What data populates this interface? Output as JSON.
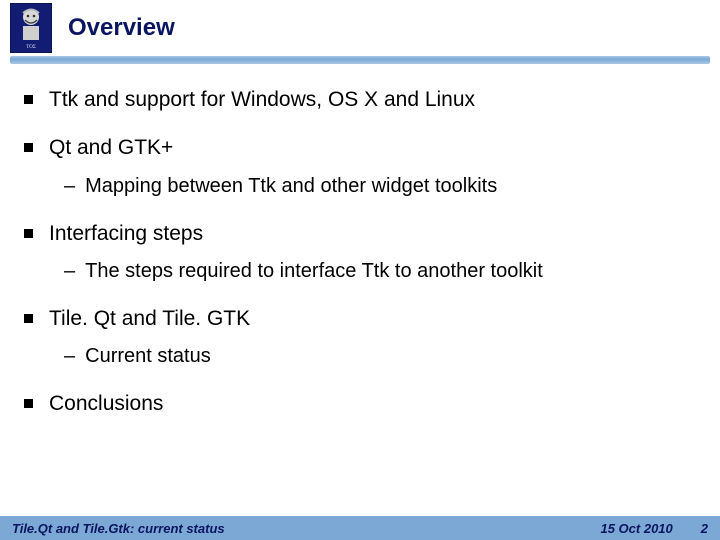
{
  "header": {
    "title": "Overview"
  },
  "bullets": [
    {
      "text": "Ttk and support for Windows, OS X and Linux",
      "sub": []
    },
    {
      "text": "Qt and GTK+",
      "sub": [
        "Mapping between Ttk and other widget toolkits"
      ]
    },
    {
      "text": "Interfacing steps",
      "sub": [
        "The steps required to interface Ttk to another toolkit"
      ]
    },
    {
      "text": "Tile. Qt and Tile. GTK",
      "sub": [
        "Current status"
      ]
    },
    {
      "text": "Conclusions",
      "sub": []
    }
  ],
  "footer": {
    "left": "Tile.Qt and Tile.Gtk: current status",
    "date": "15 Oct 2010",
    "page": "2"
  }
}
